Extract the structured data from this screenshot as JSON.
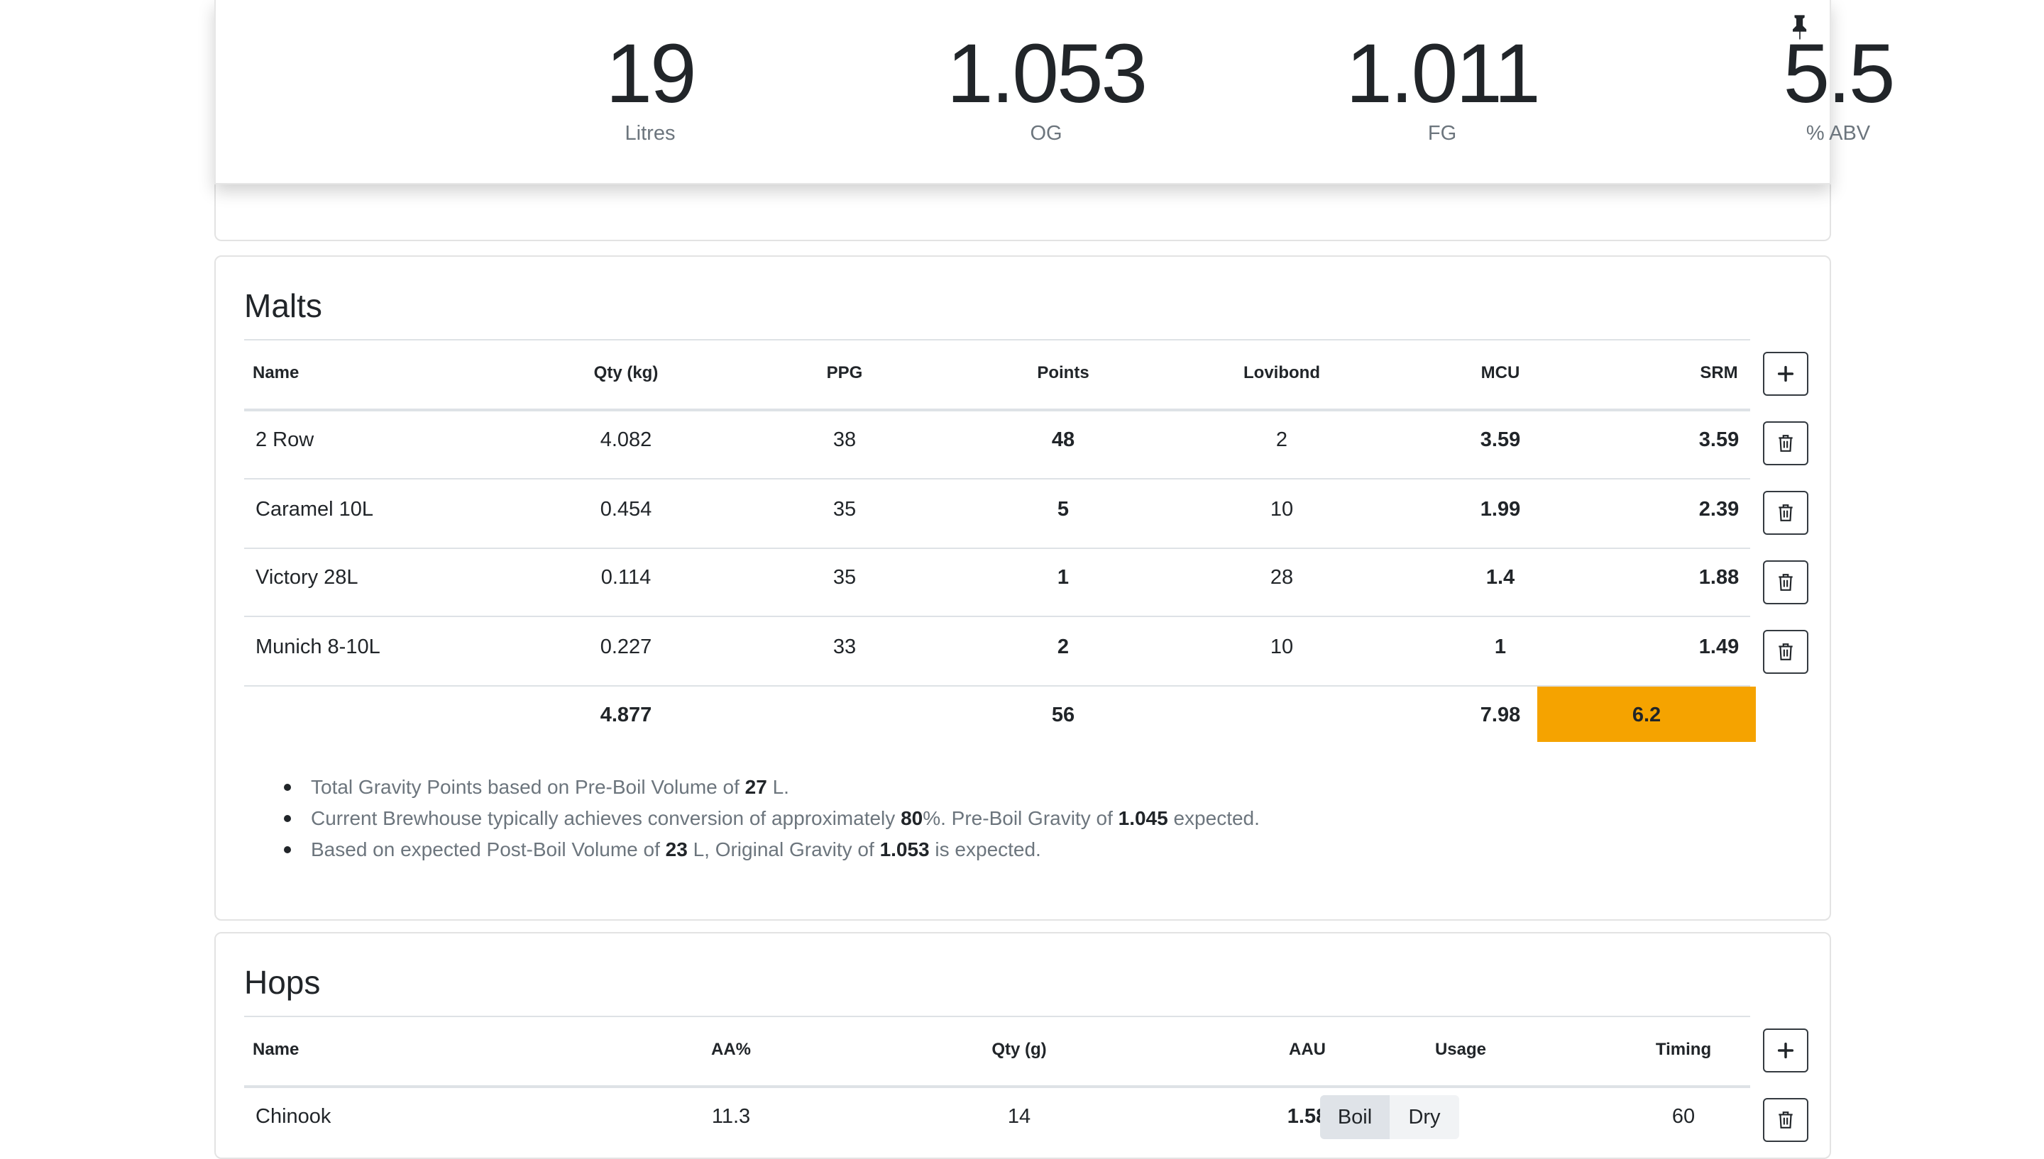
{
  "stats": [
    {
      "value": "19",
      "label": "Litres"
    },
    {
      "value": "1.053",
      "label": "OG"
    },
    {
      "value": "1.011",
      "label": "FG"
    },
    {
      "value": "5.5",
      "label": "% ABV"
    }
  ],
  "pin_icon": "pin-icon",
  "malts": {
    "title": "Malts",
    "headers": [
      "Name",
      "Qty (kg)",
      "PPG",
      "Points",
      "Lovibond",
      "MCU",
      "SRM"
    ],
    "rows": [
      {
        "name": "2 Row",
        "qty": "4.082",
        "ppg": "38",
        "points": "48",
        "lovibond": "2",
        "mcu": "3.59",
        "srm": "3.59"
      },
      {
        "name": "Caramel 10L",
        "qty": "0.454",
        "ppg": "35",
        "points": "5",
        "lovibond": "10",
        "mcu": "1.99",
        "srm": "2.39"
      },
      {
        "name": "Victory 28L",
        "qty": "0.114",
        "ppg": "35",
        "points": "1",
        "lovibond": "28",
        "mcu": "1.4",
        "srm": "1.88"
      },
      {
        "name": "Munich 8-10L",
        "qty": "0.227",
        "ppg": "33",
        "points": "2",
        "lovibond": "10",
        "mcu": "1",
        "srm": "1.49"
      }
    ],
    "totals": {
      "qty": "4.877",
      "points": "56",
      "mcu": "7.98",
      "srm": "6.2"
    },
    "srm_color": "#f5a300",
    "notes": [
      {
        "t1": "Total Gravity Points based on Pre-Boil Volume of ",
        "b1": "27",
        "t2": " L."
      },
      {
        "t1": "Current Brewhouse typically achieves conversion of approximately ",
        "b1": "80",
        "t2": "%. Pre-Boil Gravity of ",
        "b2": "1.045",
        "t3": " expected."
      },
      {
        "t1": "Based on expected Post-Boil Volume of ",
        "b1": "23",
        "t2": " L, Original Gravity of ",
        "b2": "1.053",
        "t3": " is expected."
      }
    ]
  },
  "hops": {
    "title": "Hops",
    "headers": [
      "Name",
      "AA%",
      "Qty (g)",
      "AAU",
      "Usage",
      "Timing"
    ],
    "rows": [
      {
        "name": "Chinook",
        "aa": "11.3",
        "qty": "14",
        "aau": "1.58",
        "usage_options": [
          "Boil",
          "Dry"
        ],
        "usage_selected": "Boil",
        "timing": "60"
      }
    ]
  },
  "icons": {
    "add": "plus-icon",
    "delete": "trash-icon"
  }
}
